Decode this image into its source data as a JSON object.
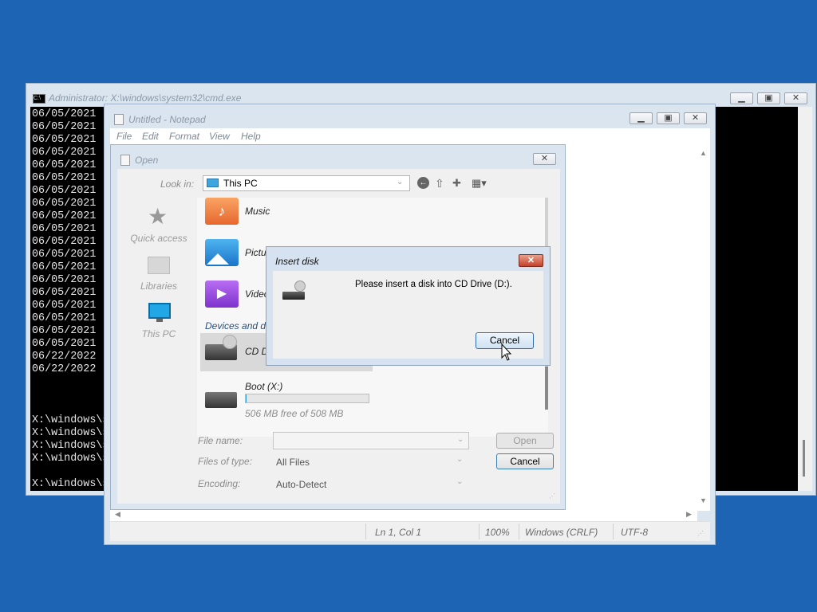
{
  "cmd": {
    "title": "Administrator: X:\\windows\\system32\\cmd.exe",
    "lines": [
      "06/05/2021",
      "06/05/2021",
      "06/05/2021",
      "06/05/2021",
      "06/05/2021",
      "06/05/2021",
      "06/05/2021",
      "06/05/2021",
      "06/05/2021",
      "06/05/2021",
      "06/05/2021",
      "06/05/2021",
      "06/05/2021",
      "06/05/2021",
      "06/05/2021",
      "06/05/2021",
      "06/05/2021",
      "06/05/2021",
      "06/05/2021",
      "06/22/2022",
      "06/22/2022"
    ],
    "prompts": [
      "X:\\windows\\s",
      "X:\\windows\\s",
      "X:\\windows\\s",
      "X:\\windows\\s",
      "X:\\windows\\s"
    ]
  },
  "notepad": {
    "title": "Untitled - Notepad",
    "menu": [
      "File",
      "Edit",
      "Format",
      "View",
      "Help"
    ],
    "status": {
      "position": "Ln 1, Col 1",
      "zoom": "100%",
      "line_ending": "Windows (CRLF)",
      "encoding": "UTF-8"
    }
  },
  "open_dialog": {
    "title": "Open",
    "look_in_label": "Look in:",
    "look_in_value": "This PC",
    "places": [
      "Quick access",
      "Libraries",
      "This PC"
    ],
    "folders": [
      "Music",
      "Pictur",
      "Video"
    ],
    "section_header": "Devices and d",
    "drives": [
      {
        "name": "CD D"
      },
      {
        "name": "Boot (X:)",
        "free_text": "506 MB free of 508 MB",
        "used_fraction": 0.004
      }
    ],
    "file_name_label": "File name:",
    "file_name_value": "",
    "files_of_type_label": "Files of type:",
    "files_of_type_value": "All Files",
    "encoding_label": "Encoding:",
    "encoding_value": "Auto-Detect",
    "open_button": "Open",
    "cancel_button": "Cancel"
  },
  "insert_disk": {
    "title": "Insert disk",
    "message": "Please insert a disk into CD Drive (D:).",
    "cancel_button": "Cancel"
  }
}
